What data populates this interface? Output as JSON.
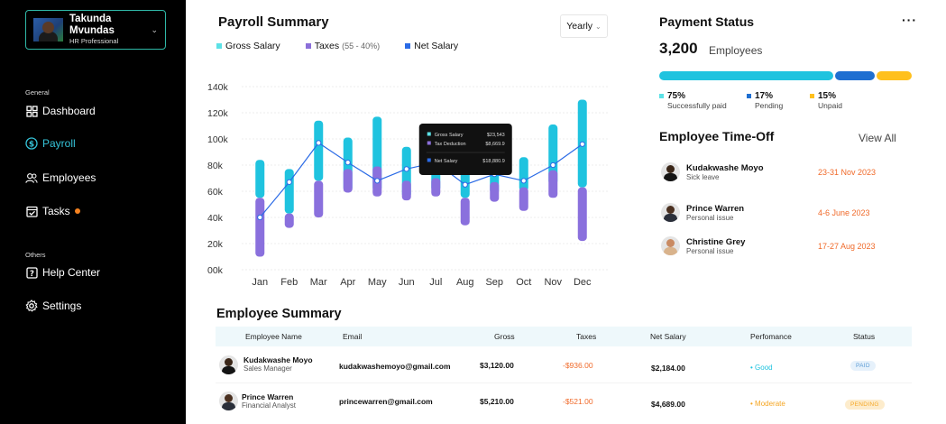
{
  "user": {
    "name": "Takunda Mvundas",
    "role": "HR Professional"
  },
  "sidebar": {
    "general_label": "General",
    "others_label": "Others",
    "items": [
      {
        "label": "Dashboard",
        "icon": "dashboard-icon"
      },
      {
        "label": "Payroll",
        "icon": "dollar-circle-icon"
      },
      {
        "label": "Employees",
        "icon": "users-icon"
      },
      {
        "label": "Tasks",
        "icon": "checkbox-icon"
      },
      {
        "label": "Help Center",
        "icon": "question-icon"
      },
      {
        "label": "Settings",
        "icon": "gear-icon"
      }
    ],
    "active_index": 1
  },
  "payroll": {
    "title": "Payroll Summary",
    "period": "Yearly",
    "legend": [
      {
        "label": "Gross Salary",
        "sub": "",
        "color": "#5ce1e6"
      },
      {
        "label": "Taxes",
        "sub": "(55 - 40%)",
        "color": "#8b6fd9"
      },
      {
        "label": "Net Salary",
        "sub": "",
        "color": "#2b6be6"
      }
    ],
    "tooltip": {
      "rows": [
        {
          "label": "Gross Salary",
          "value": "$23,543",
          "color": "#5ce1e6"
        },
        {
          "label": "Tax Deduction",
          "value": "$8,669.9",
          "color": "#8b6fd9"
        },
        {
          "label": "Net Salary",
          "value": "$18,880.9",
          "color": "#2b6be6"
        }
      ]
    }
  },
  "chart_data": {
    "type": "bar",
    "categories": [
      "Jan",
      "Feb",
      "Mar",
      "Apr",
      "May",
      "Jun",
      "Jul",
      "Aug",
      "Sep",
      "Oct",
      "Nov",
      "Dec"
    ],
    "yticks": [
      "00k",
      "20k",
      "40k",
      "60k",
      "80k",
      "100k",
      "120k",
      "140k"
    ],
    "ylim": [
      0,
      140000
    ],
    "grid": true,
    "series": [
      {
        "name": "Gross Salary",
        "color": "#1fc3df",
        "low": [
          55000,
          43000,
          68000,
          60000,
          60000,
          55000,
          60000,
          55000,
          58000,
          60000,
          65000,
          63000
        ],
        "high": [
          84000,
          77000,
          114000,
          101000,
          117000,
          94000,
          95000,
          82000,
          90000,
          86000,
          111000,
          130000
        ]
      },
      {
        "name": "Taxes",
        "color": "#8a70dd",
        "low": [
          10000,
          32000,
          40000,
          59000,
          56000,
          53000,
          56000,
          34000,
          52000,
          45000,
          55000,
          22000
        ],
        "high": [
          55000,
          43000,
          68000,
          77000,
          79000,
          68000,
          70000,
          55000,
          67000,
          63000,
          76000,
          63000
        ]
      },
      {
        "name": "Net Salary",
        "color": "#2b6be6",
        "values": [
          40000,
          67000,
          97000,
          82000,
          68000,
          77000,
          82000,
          65000,
          73000,
          68000,
          80000,
          96000
        ]
      }
    ]
  },
  "payment_status": {
    "title": "Payment Status",
    "count": "3,200",
    "count_label": "Employees",
    "segments": [
      {
        "pct": "75%",
        "label": "Successfully paid",
        "color": "#1fc3df",
        "fraction": 0.75
      },
      {
        "pct": "17%",
        "label": "Pending",
        "color": "#1f6fd1",
        "fraction": 0.17
      },
      {
        "pct": "15%",
        "label": "Unpaid",
        "color": "#ffc01e",
        "fraction": 0.15
      }
    ]
  },
  "time_off": {
    "title": "Employee Time-Off",
    "view_all": "View All",
    "items": [
      {
        "name": "Kudakwashe Moyo",
        "type": "Sick leave",
        "dates": "23-31 Nov 2023"
      },
      {
        "name": "Prince Warren",
        "type": "Personal issue",
        "dates": "4-6 June 2023"
      },
      {
        "name": "Christine Grey",
        "type": "Personal issue",
        "dates": "17-27 Aug 2023"
      }
    ]
  },
  "employee_summary": {
    "title": "Employee Summary",
    "columns": [
      "Employee Name",
      "Email",
      "Gross",
      "Taxes",
      "Net Salary",
      "Perfomance",
      "Status"
    ],
    "rows": [
      {
        "name": "Kudakwashe Moyo",
        "role": "Sales Manager",
        "email": "kudakwashemoyo@gmail.com",
        "gross": "$3,120.00",
        "taxes": "-$936.00",
        "net": "$2,184.00",
        "performance": "Good",
        "perf_color": "#1fc3df",
        "status": "PAID",
        "status_color": "#5b9bd5",
        "status_bg": "#e6f1fb"
      },
      {
        "name": "Prince Warren",
        "role": "Financial Analyst",
        "email": "princewarren@gmail.com",
        "gross": "$5,210.00",
        "taxes": "-$521.00",
        "net": "$4,689.00",
        "performance": "Moderate",
        "perf_color": "#f5a623",
        "status": "PENDING",
        "status_color": "#f5a623",
        "status_bg": "#fdeccc"
      }
    ]
  }
}
